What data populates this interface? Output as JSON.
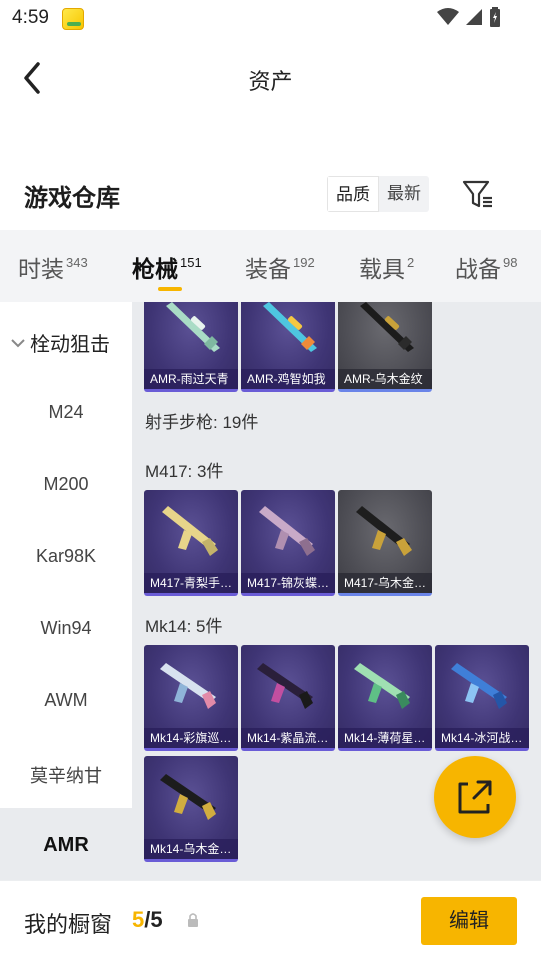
{
  "status_bar": {
    "time": "4:59"
  },
  "header": {
    "title": "资产"
  },
  "warehouse": {
    "title": "游戏仓库",
    "sort_options": [
      {
        "label": "品质",
        "active": true
      },
      {
        "label": "最新",
        "active": false
      }
    ]
  },
  "tabs": [
    {
      "label": "时装",
      "count": "343"
    },
    {
      "label": "枪械",
      "count": "151"
    },
    {
      "label": "装备",
      "count": "192"
    },
    {
      "label": "载具",
      "count": "2"
    },
    {
      "label": "战备",
      "count": "98"
    }
  ],
  "sidebar": {
    "group": "栓动狙击",
    "items": [
      "M24",
      "M200",
      "Kar98K",
      "Win94",
      "AWM",
      "莫辛纳甘",
      "AMR"
    ]
  },
  "content": {
    "amr_items": [
      "AMR-雨过天青",
      "AMR-鸡智如我",
      "AMR-乌木金纹"
    ],
    "category_label": "射手步枪: 19件",
    "m417_label": "M417: 3件",
    "m417_items": [
      "M417-青梨手…",
      "M417-锦灰蝶…",
      "M417-乌木金…"
    ],
    "mk14_label": "Mk14: 5件",
    "mk14_items": [
      "Mk14-彩旗巡…",
      "Mk14-紫晶流…",
      "Mk14-薄荷星…",
      "Mk14-冰河战…",
      "Mk14-乌木金…"
    ]
  },
  "bottom_bar": {
    "label": "我的橱窗",
    "current": "5",
    "separator": "/",
    "max": "5",
    "edit_label": "编辑"
  },
  "colors": {
    "accent": "#f7b500",
    "card_purple": "#3f3575",
    "card_gold": "#4e4e55"
  }
}
